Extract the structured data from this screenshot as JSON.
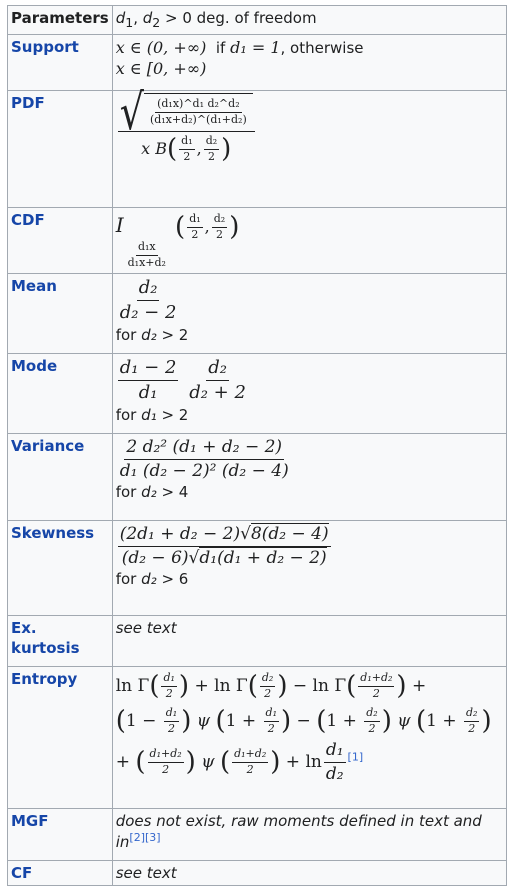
{
  "rows": {
    "parameters": {
      "label": "Parameters",
      "d": "d",
      "s1": "1",
      "s2": "2",
      "sep": ", ",
      "rest": " > 0 deg. of freedom"
    },
    "support": {
      "label": "Support",
      "line1": "x ∈ (0, +∞)",
      "if": "  if ",
      "cond": "d₁ = 1",
      "otherwise": ", otherwise",
      "line2": "x ∈ [0, +∞)"
    },
    "pdf": {
      "label": "PDF",
      "inner_num": "(d₁x)^d₁ d₂^d₂",
      "inner_den": "(d₁x+d₂)^(d₁+d₂)",
      "den": "x B",
      "a_num": "d₁",
      "a_den": "2",
      "b_num": "d₂",
      "b_den": "2"
    },
    "cdf": {
      "label": "CDF",
      "I": "I",
      "sub_num": "d₁x",
      "sub_den": "d₁x+d₂",
      "a_num": "d₁",
      "a_den": "2",
      "b_num": "d₂",
      "b_den": "2"
    },
    "mean": {
      "label": "Mean",
      "num": "d₂",
      "den": "d₂ − 2",
      "cond_pre": "for ",
      "cond_var": "d₂",
      "cond_post": " > 2"
    },
    "mode": {
      "label": "Mode",
      "num1": "d₁ − 2",
      "den1": "d₁",
      "num2": "d₂",
      "den2": "d₂ + 2",
      "cond_pre": "for ",
      "cond_var": "d₁",
      "cond_post": " > 2"
    },
    "variance": {
      "label": "Variance",
      "num": "2 d₂² (d₁ + d₂ − 2)",
      "den": "d₁ (d₂ − 2)² (d₂ − 4)",
      "cond_pre": "for ",
      "cond_var": "d₂",
      "cond_post": " > 4"
    },
    "skewness": {
      "label": "Skewness",
      "num_a": "(2d₁ + d₂ − 2)",
      "num_sqrt": "8(d₂ − 4)",
      "den_a": "(d₂ − 6)",
      "den_sqrt": "d₁(d₁ + d₂ − 2)",
      "cond_pre": "for ",
      "cond_var": "d₂",
      "cond_post": " > 6"
    },
    "kurtosis": {
      "label": "Ex. kurtosis",
      "value": "see text"
    },
    "entropy": {
      "label": "Entropy",
      "line1": {
        "lnG": "ln Γ",
        "f1n": "d₁",
        "f1d": "2",
        "plus": " + ln Γ",
        "f2n": "d₂",
        "f2d": "2",
        "minus": " − ln Γ",
        "f3n": "d₁+d₂",
        "f3d": "2",
        "end": " +"
      },
      "line2": {
        "a": "1 − ",
        "f1n": "d₁",
        "f1d": "2",
        "psi": " ψ ",
        "b": "1 + ",
        "f2n": "d₁",
        "f2d": "2",
        "minus": " − ",
        "c": "1 + ",
        "f3n": "d₂",
        "f3d": "2",
        "psi2": " ψ ",
        "d": "1 + ",
        "f4n": "d₂",
        "f4d": "2"
      },
      "line3": {
        "plus": "+ ",
        "f1n": "d₁+d₂",
        "f1d": "2",
        "psi": " ψ ",
        "f2n": "d₁+d₂",
        "f2d": "2",
        "ln": " + ln",
        "f3n": "d₁",
        "f3d": "d₂"
      },
      "ref": "[1]"
    },
    "mgf": {
      "label": "MGF",
      "value": "does not exist, raw moments defined in text and in",
      "ref2": "[2]",
      "ref3": "[3]"
    },
    "cf": {
      "label": "CF",
      "value": "see text"
    }
  },
  "colors": {
    "link": "#1646a8",
    "background": "#f8f9fa",
    "border": "#a2a9b1"
  }
}
